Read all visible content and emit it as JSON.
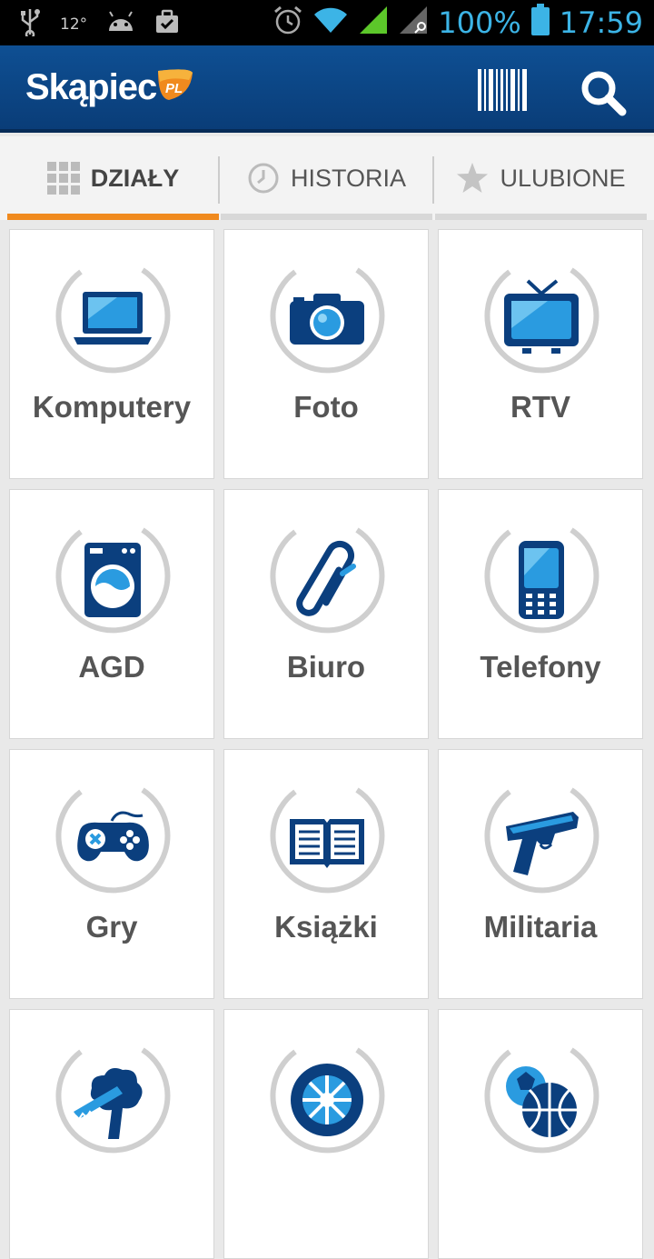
{
  "status_bar": {
    "temperature": "12°",
    "battery_percent": "100%",
    "time": "17:59",
    "left_icons": [
      "usb-icon",
      "android-icon",
      "briefcase-check-icon"
    ],
    "right_icons": [
      "alarm-icon",
      "wifi-icon",
      "signal-icon",
      "signal-search-icon",
      "battery-icon"
    ]
  },
  "app_bar": {
    "logo_text": "Skąpiec",
    "logo_badge": "PL",
    "icons": [
      "barcode-icon",
      "search-icon"
    ]
  },
  "tabs": [
    {
      "label": "DZIAŁY",
      "icon": "grid-icon",
      "active": true
    },
    {
      "label": "HISTORIA",
      "icon": "clock-icon",
      "active": false
    },
    {
      "label": "ULUBIONE",
      "icon": "star-icon",
      "active": false
    }
  ],
  "categories": [
    {
      "label": "Komputery",
      "icon": "laptop-icon"
    },
    {
      "label": "Foto",
      "icon": "camera-icon"
    },
    {
      "label": "RTV",
      "icon": "tv-icon"
    },
    {
      "label": "AGD",
      "icon": "washing-machine-icon"
    },
    {
      "label": "Biuro",
      "icon": "paperclip-icon"
    },
    {
      "label": "Telefony",
      "icon": "phone-icon"
    },
    {
      "label": "Gry",
      "icon": "gamepad-icon"
    },
    {
      "label": "Książki",
      "icon": "book-icon"
    },
    {
      "label": "Militaria",
      "icon": "pistol-icon"
    },
    {
      "label": "",
      "icon": "garden-saw-tree-icon"
    },
    {
      "label": "",
      "icon": "tire-icon"
    },
    {
      "label": "",
      "icon": "sports-balls-icon"
    }
  ],
  "colors": {
    "brand_blue": "#0c4586",
    "accent_orange": "#f08a1e",
    "icon_blue": "#0b3f7e",
    "icon_light_blue": "#2a9be0",
    "status_blue": "#3cb4e6"
  }
}
